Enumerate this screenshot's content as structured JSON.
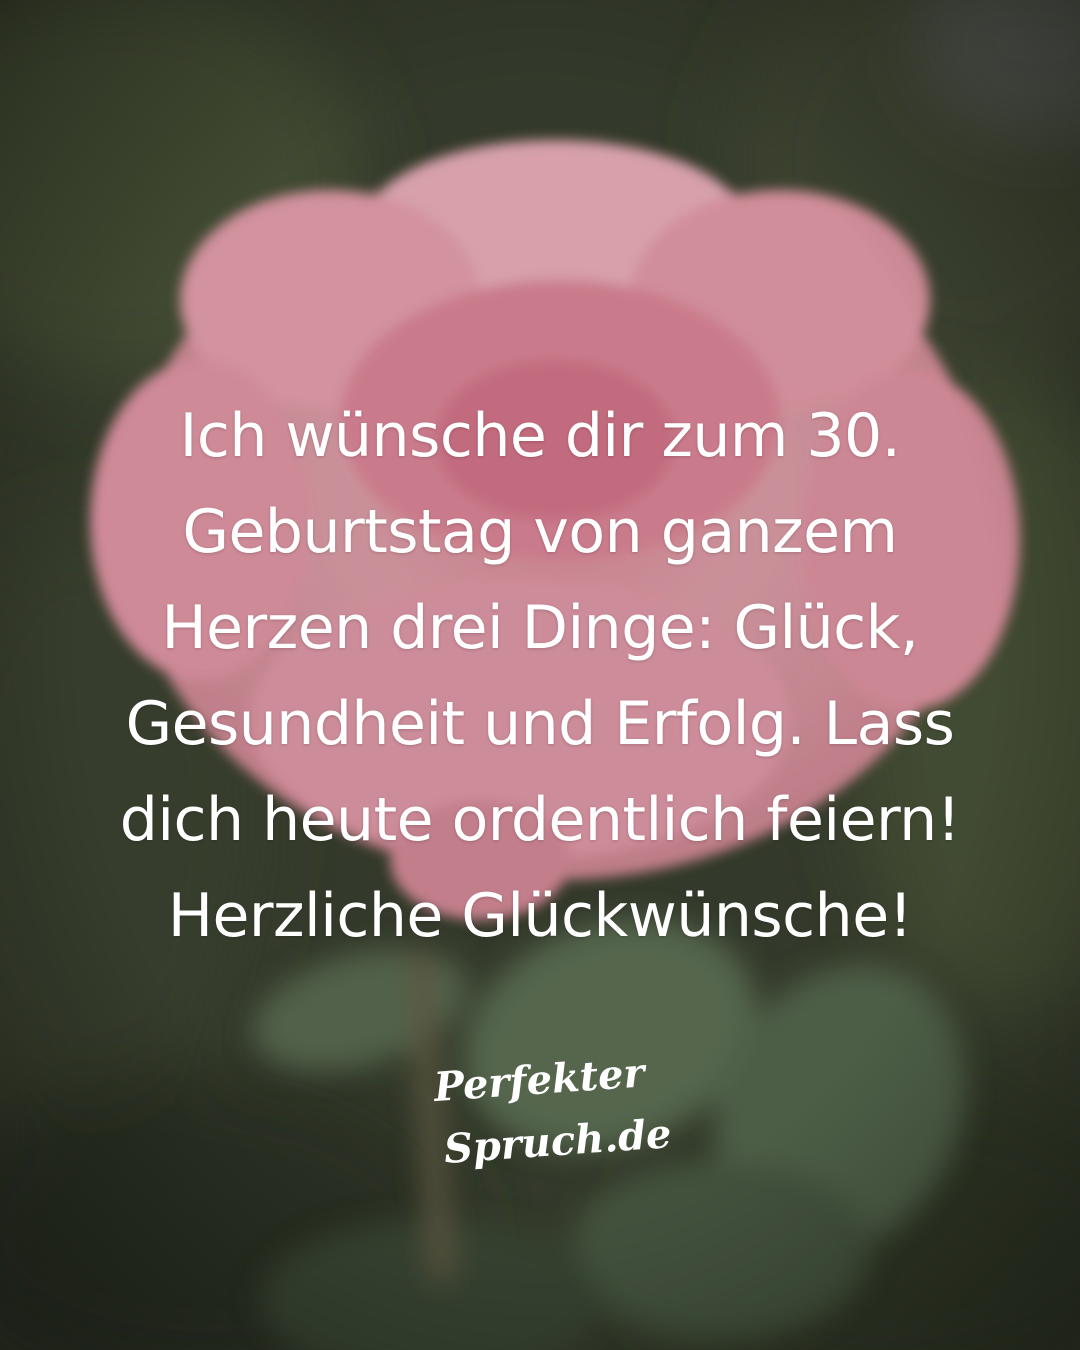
{
  "quote": {
    "lines": [
      "Ich wünsche dir zum 30.",
      "Geburtstag von ganzem",
      "Herzen drei Dinge: Glück,",
      "Gesundheit und Erfolg. Lass",
      "dich heute ordentlich feiern!",
      "Herzliche Glückwünsche!"
    ]
  },
  "brand": {
    "line1": "Perfekter",
    "line2": "Spruch.de"
  },
  "colors": {
    "text": "#ffffff",
    "rose": "#e9a3b1",
    "leaves": "#4d5a40",
    "background": "#3b4231"
  }
}
